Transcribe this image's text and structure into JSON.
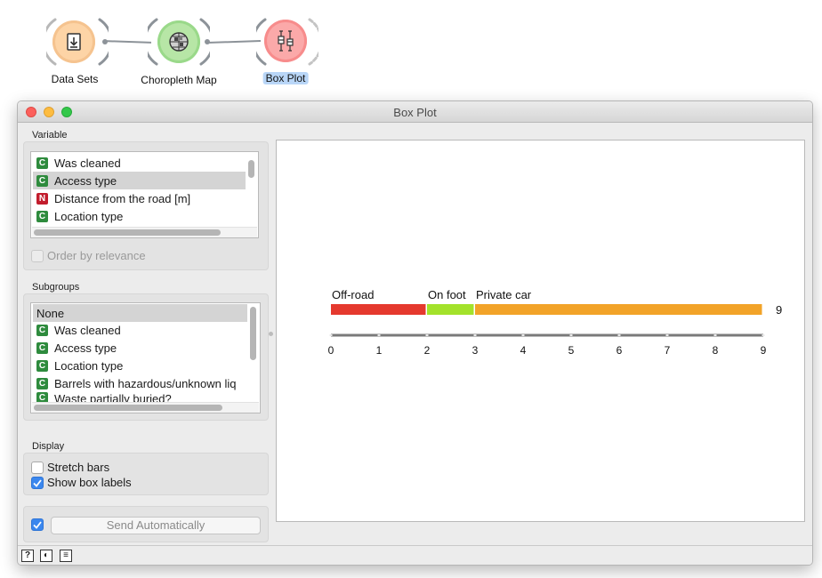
{
  "workflow": {
    "nodes": [
      {
        "label": "Data Sets",
        "icon": "download-icon",
        "color": "#fdd4a6",
        "ring": "#f5b877"
      },
      {
        "label": "Choropleth Map",
        "icon": "globe-icon",
        "color": "#b7e6a6",
        "ring": "#8dd17a"
      },
      {
        "label": "Box Plot",
        "icon": "box-plot-icon",
        "color": "#fba9a9",
        "ring": "#f57f7f"
      }
    ]
  },
  "window": {
    "title": "Box Plot",
    "traffic_colors": {
      "close": "#fc605c",
      "minimize": "#fdbc40",
      "zoom": "#34c84a"
    }
  },
  "variable_section": {
    "title": "Variable",
    "items": [
      {
        "type": "C",
        "label": "Was cleaned"
      },
      {
        "type": "C",
        "label": "Access type"
      },
      {
        "type": "N",
        "label": "Distance from the road [m]"
      },
      {
        "type": "C",
        "label": "Location type"
      }
    ],
    "selected_index": 1,
    "order_by_relevance": {
      "label": "Order by relevance",
      "checked": false,
      "enabled": false
    }
  },
  "subgroups_section": {
    "title": "Subgroups",
    "items": [
      {
        "type": "",
        "label": "None"
      },
      {
        "type": "C",
        "label": "Was cleaned"
      },
      {
        "type": "C",
        "label": "Access type"
      },
      {
        "type": "C",
        "label": "Location type"
      },
      {
        "type": "C",
        "label": "Barrels with hazardous/unknown liq"
      },
      {
        "type": "C",
        "label": "Waste partially buried?"
      }
    ],
    "selected_index": 0
  },
  "display_section": {
    "title": "Display",
    "stretch_bars": {
      "label": "Stretch bars",
      "checked": false
    },
    "show_box_labels": {
      "label": "Show box labels",
      "checked": true
    }
  },
  "send": {
    "label": "Send Automatically",
    "checked": true
  },
  "chart_data": {
    "type": "bar",
    "orientation": "horizontal-stacked",
    "categories": [
      "Off-road",
      "On foot",
      "Private car"
    ],
    "values": [
      2,
      1,
      6
    ],
    "colors": [
      "#e5392e",
      "#a3e22b",
      "#f2a328"
    ],
    "total_label": "9",
    "xlim": [
      0,
      9
    ],
    "ticks": [
      "0",
      "1",
      "2",
      "3",
      "4",
      "5",
      "6",
      "7",
      "8",
      "9"
    ],
    "title": "",
    "xlabel": "",
    "ylabel": ""
  },
  "status_icons": [
    "help-icon",
    "report-icon",
    "info-icon"
  ]
}
